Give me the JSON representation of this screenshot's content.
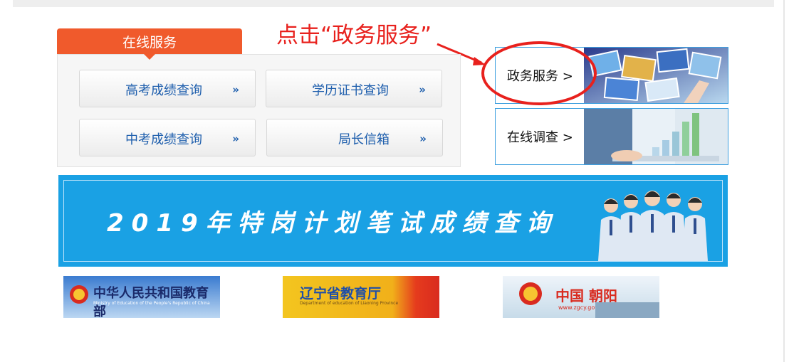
{
  "annotation": {
    "text": "点击“政务服务”"
  },
  "services": {
    "tab_title": "在线服务",
    "buttons": [
      {
        "label": "高考成绩查询",
        "arrow": "»"
      },
      {
        "label": "学历证书查询",
        "arrow": "»"
      },
      {
        "label": "中考成绩查询",
        "arrow": "»"
      },
      {
        "label": "局长信箱",
        "arrow": "»"
      }
    ]
  },
  "cards": [
    {
      "label": "政务服务 >"
    },
    {
      "label": "在线调查 >"
    }
  ],
  "banner": {
    "text": "2019年特岗计划笔试成绩查询"
  },
  "links": [
    {
      "title": "中华人民共和国教育部",
      "subtitle": "Ministry of Education of the People's Republic of China"
    },
    {
      "title": "辽宁省教育厅",
      "subtitle": "Department of education of Liaoning Province"
    },
    {
      "title": "中国 朝阳",
      "subtitle": "www.zgcy.gov.cn"
    }
  ],
  "colors": {
    "annotation": "#e8211d",
    "service_tab": "#f05a2c",
    "service_text": "#1f5fad",
    "card_border": "#3fa0df",
    "banner_bg": "#1aa1e4"
  }
}
